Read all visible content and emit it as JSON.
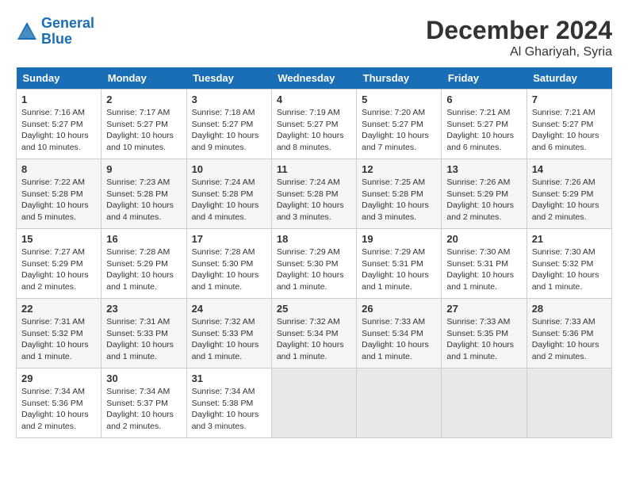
{
  "logo": {
    "line1": "General",
    "line2": "Blue"
  },
  "title": "December 2024",
  "location": "Al Ghariyah, Syria",
  "days_header": [
    "Sunday",
    "Monday",
    "Tuesday",
    "Wednesday",
    "Thursday",
    "Friday",
    "Saturday"
  ],
  "weeks": [
    [
      {
        "day": "1",
        "info": "Sunrise: 7:16 AM\nSunset: 5:27 PM\nDaylight: 10 hours\nand 10 minutes."
      },
      {
        "day": "2",
        "info": "Sunrise: 7:17 AM\nSunset: 5:27 PM\nDaylight: 10 hours\nand 10 minutes."
      },
      {
        "day": "3",
        "info": "Sunrise: 7:18 AM\nSunset: 5:27 PM\nDaylight: 10 hours\nand 9 minutes."
      },
      {
        "day": "4",
        "info": "Sunrise: 7:19 AM\nSunset: 5:27 PM\nDaylight: 10 hours\nand 8 minutes."
      },
      {
        "day": "5",
        "info": "Sunrise: 7:20 AM\nSunset: 5:27 PM\nDaylight: 10 hours\nand 7 minutes."
      },
      {
        "day": "6",
        "info": "Sunrise: 7:21 AM\nSunset: 5:27 PM\nDaylight: 10 hours\nand 6 minutes."
      },
      {
        "day": "7",
        "info": "Sunrise: 7:21 AM\nSunset: 5:27 PM\nDaylight: 10 hours\nand 6 minutes."
      }
    ],
    [
      {
        "day": "8",
        "info": "Sunrise: 7:22 AM\nSunset: 5:28 PM\nDaylight: 10 hours\nand 5 minutes."
      },
      {
        "day": "9",
        "info": "Sunrise: 7:23 AM\nSunset: 5:28 PM\nDaylight: 10 hours\nand 4 minutes."
      },
      {
        "day": "10",
        "info": "Sunrise: 7:24 AM\nSunset: 5:28 PM\nDaylight: 10 hours\nand 4 minutes."
      },
      {
        "day": "11",
        "info": "Sunrise: 7:24 AM\nSunset: 5:28 PM\nDaylight: 10 hours\nand 3 minutes."
      },
      {
        "day": "12",
        "info": "Sunrise: 7:25 AM\nSunset: 5:28 PM\nDaylight: 10 hours\nand 3 minutes."
      },
      {
        "day": "13",
        "info": "Sunrise: 7:26 AM\nSunset: 5:29 PM\nDaylight: 10 hours\nand 2 minutes."
      },
      {
        "day": "14",
        "info": "Sunrise: 7:26 AM\nSunset: 5:29 PM\nDaylight: 10 hours\nand 2 minutes."
      }
    ],
    [
      {
        "day": "15",
        "info": "Sunrise: 7:27 AM\nSunset: 5:29 PM\nDaylight: 10 hours\nand 2 minutes."
      },
      {
        "day": "16",
        "info": "Sunrise: 7:28 AM\nSunset: 5:29 PM\nDaylight: 10 hours\nand 1 minute."
      },
      {
        "day": "17",
        "info": "Sunrise: 7:28 AM\nSunset: 5:30 PM\nDaylight: 10 hours\nand 1 minute."
      },
      {
        "day": "18",
        "info": "Sunrise: 7:29 AM\nSunset: 5:30 PM\nDaylight: 10 hours\nand 1 minute."
      },
      {
        "day": "19",
        "info": "Sunrise: 7:29 AM\nSunset: 5:31 PM\nDaylight: 10 hours\nand 1 minute."
      },
      {
        "day": "20",
        "info": "Sunrise: 7:30 AM\nSunset: 5:31 PM\nDaylight: 10 hours\nand 1 minute."
      },
      {
        "day": "21",
        "info": "Sunrise: 7:30 AM\nSunset: 5:32 PM\nDaylight: 10 hours\nand 1 minute."
      }
    ],
    [
      {
        "day": "22",
        "info": "Sunrise: 7:31 AM\nSunset: 5:32 PM\nDaylight: 10 hours\nand 1 minute."
      },
      {
        "day": "23",
        "info": "Sunrise: 7:31 AM\nSunset: 5:33 PM\nDaylight: 10 hours\nand 1 minute."
      },
      {
        "day": "24",
        "info": "Sunrise: 7:32 AM\nSunset: 5:33 PM\nDaylight: 10 hours\nand 1 minute."
      },
      {
        "day": "25",
        "info": "Sunrise: 7:32 AM\nSunset: 5:34 PM\nDaylight: 10 hours\nand 1 minute."
      },
      {
        "day": "26",
        "info": "Sunrise: 7:33 AM\nSunset: 5:34 PM\nDaylight: 10 hours\nand 1 minute."
      },
      {
        "day": "27",
        "info": "Sunrise: 7:33 AM\nSunset: 5:35 PM\nDaylight: 10 hours\nand 1 minute."
      },
      {
        "day": "28",
        "info": "Sunrise: 7:33 AM\nSunset: 5:36 PM\nDaylight: 10 hours\nand 2 minutes."
      }
    ],
    [
      {
        "day": "29",
        "info": "Sunrise: 7:34 AM\nSunset: 5:36 PM\nDaylight: 10 hours\nand 2 minutes."
      },
      {
        "day": "30",
        "info": "Sunrise: 7:34 AM\nSunset: 5:37 PM\nDaylight: 10 hours\nand 2 minutes."
      },
      {
        "day": "31",
        "info": "Sunrise: 7:34 AM\nSunset: 5:38 PM\nDaylight: 10 hours\nand 3 minutes."
      },
      null,
      null,
      null,
      null
    ]
  ]
}
